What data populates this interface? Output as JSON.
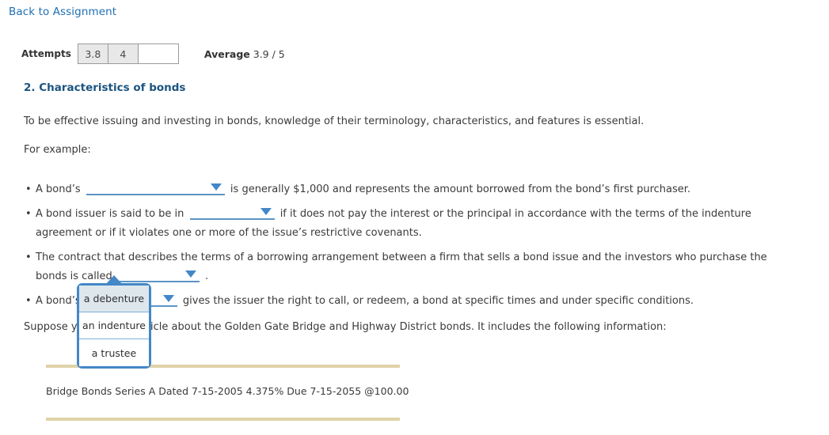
{
  "nav": {
    "back_link": "Back to Assignment"
  },
  "attempts": {
    "label": "Attempts",
    "cells": [
      "3.8",
      "4",
      ""
    ],
    "average_label": "Average",
    "average_value": "3.9 / 5"
  },
  "section": {
    "title": "2. Characteristics of bonds",
    "intro": "To be effective issuing and investing in bonds, knowledge of their terminology, characteristics, and features is essential.",
    "example_label": "For example:"
  },
  "bullets": [
    {
      "before": "A bond’s",
      "after": "is generally $1,000 and represents the amount borrowed from the bond’s first purchaser.",
      "dropdown_value": ""
    },
    {
      "before": "A bond issuer is said to be in",
      "after": "if it does not pay the interest or the principal in accordance with the terms of the indenture agreement or if it violates one or more of the issue’s restrictive covenants.",
      "dropdown_value": ""
    },
    {
      "before": "The contract that describes the terms of a borrowing arrangement between a firm that sells a bond issue and the investors who purchase the bonds is called",
      "after": ".",
      "dropdown_value": ""
    },
    {
      "before": "A bond’s",
      "after": "gives the issuer the right to call, or redeem, a bond at specific times and under specific conditions.",
      "dropdown_value": ""
    }
  ],
  "open_dropdown": {
    "options": [
      "a debenture",
      "an indenture",
      "a trustee"
    ],
    "selected_index": 0
  },
  "suppose": "Suppose you read an article about the Golden Gate Bridge and Highway District bonds. It includes the following information:",
  "quote": {
    "text": "Bridge Bonds Series A Dated 7-15-2005 4.375% Due 7-15-2055 @100.00"
  },
  "colors": {
    "link": "#1f6fb2",
    "heading": "#1b5480",
    "dropdown_accent": "#4387c7",
    "rule": "#dfd3a8",
    "option_selected": "#dde7ec"
  }
}
